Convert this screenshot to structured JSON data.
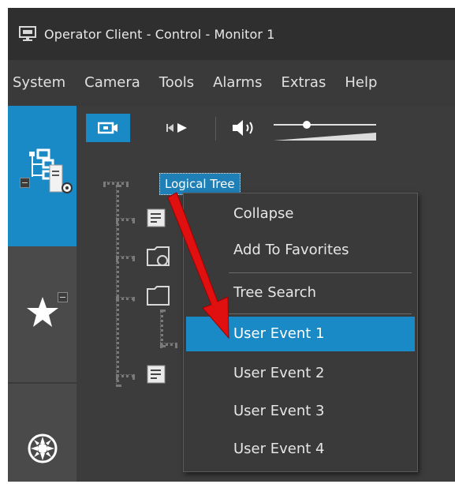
{
  "window": {
    "title": "Operator Client - Control - Monitor 1",
    "app_icon": "monitor-icon"
  },
  "menubar": {
    "items": [
      "System",
      "Camera",
      "Tools",
      "Alarms",
      "Extras",
      "Help"
    ]
  },
  "leftnav": {
    "tabs": [
      {
        "icon": "logical-tree-icon",
        "active": true
      },
      {
        "icon": "star-icon",
        "active": false
      },
      {
        "icon": "compass-icon",
        "active": false
      }
    ]
  },
  "toolbar": {
    "buttons": [
      {
        "icon": "camera-icon",
        "active": true
      },
      {
        "icon": "playback-icon",
        "active": false
      },
      {
        "icon": "speaker-icon",
        "active": false
      },
      {
        "icon": "volume-slider-icon",
        "active": false
      }
    ]
  },
  "tree": {
    "root_label": "Logical Tree"
  },
  "context_menu": {
    "items": [
      {
        "label": "Collapse",
        "selected": false
      },
      {
        "label": "Add To Favorites",
        "selected": false
      },
      {
        "label": "Tree Search",
        "selected": false
      },
      {
        "label": "User Event 1",
        "selected": true
      },
      {
        "label": "User Event 2",
        "selected": false
      },
      {
        "label": "User Event 3",
        "selected": false
      },
      {
        "label": "User Event 4",
        "selected": false
      }
    ]
  },
  "colors": {
    "accent": "#1a8ac6",
    "arrow": "#e01010",
    "background": "#3c3c3c"
  }
}
